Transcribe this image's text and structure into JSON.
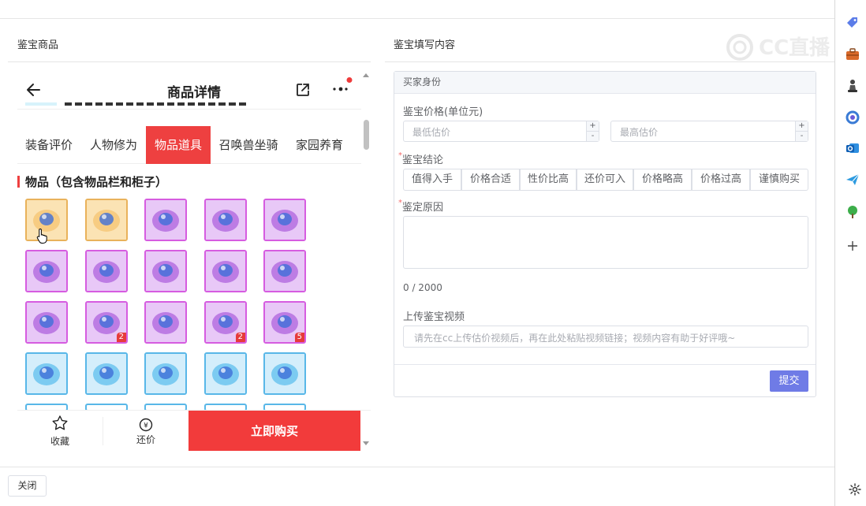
{
  "left_section": {
    "title": "鉴宝商品"
  },
  "right_section": {
    "title": "鉴宝填写内容"
  },
  "phone": {
    "title": "商品详情",
    "tabs": [
      {
        "label": "装备评价",
        "active": false
      },
      {
        "label": "人物修为",
        "active": false
      },
      {
        "label": "物品道具",
        "active": true
      },
      {
        "label": "召唤兽坐骑",
        "active": false
      },
      {
        "label": "家园养育",
        "active": false
      }
    ],
    "items_heading": "物品（包含物品栏和柜子）",
    "items": [
      {
        "name": "item-bracelet-pink",
        "border": "gold",
        "badge": ""
      },
      {
        "name": "item-wings-gold",
        "border": "gold",
        "badge": ""
      },
      {
        "name": "item-ring-blue-gem",
        "border": "purple",
        "badge": ""
      },
      {
        "name": "item-ring-gold-blue",
        "border": "purple",
        "badge": ""
      },
      {
        "name": "item-armor-purple",
        "border": "purple",
        "badge": ""
      },
      {
        "name": "item-amulet-gold",
        "border": "purple",
        "badge": ""
      },
      {
        "name": "item-belt-gold",
        "border": "purple",
        "badge": ""
      },
      {
        "name": "item-necklace-green",
        "border": "purple",
        "badge": ""
      },
      {
        "name": "item-boots-blue",
        "border": "purple",
        "badge": ""
      },
      {
        "name": "item-boots-blue-2",
        "border": "purple",
        "badge": ""
      },
      {
        "name": "item-orb-purple",
        "border": "purple",
        "badge": ""
      },
      {
        "name": "item-book-red",
        "border": "purple",
        "badge": "2"
      },
      {
        "name": "item-crystal-purple",
        "border": "purple",
        "badge": ""
      },
      {
        "name": "item-scroll-gold",
        "border": "purple",
        "badge": "2"
      },
      {
        "name": "item-chest-gold",
        "border": "purple",
        "badge": "5"
      },
      {
        "name": "item-collar-gold",
        "border": "blue",
        "badge": ""
      },
      {
        "name": "item-ring-silver",
        "border": "blue",
        "badge": ""
      },
      {
        "name": "item-robe-purple",
        "border": "blue",
        "badge": ""
      },
      {
        "name": "item-armor-blue",
        "border": "blue",
        "badge": ""
      },
      {
        "name": "item-ring-red-gem",
        "border": "blue",
        "badge": ""
      }
    ],
    "footer": {
      "favorite_label": "收藏",
      "bargain_label": "还价",
      "buy_label": "立即购买"
    }
  },
  "form": {
    "header": "买家身份",
    "price_label": "鉴宝价格(单位元)",
    "min_placeholder": "最低估价",
    "max_placeholder": "最高估价",
    "conclusion_label": "鉴宝结论",
    "conclusions": [
      "值得入手",
      "价格合适",
      "性价比高",
      "还价可入",
      "价格略高",
      "价格过高",
      "谨慎购买"
    ],
    "reason_label": "鉴定原因",
    "counter": "0 / 2000",
    "video_label": "上传鉴宝视频",
    "video_placeholder": "请先在cc上传估价视频后，再在此处粘贴视频链接；视频内容有助于好评哦~",
    "submit_label": "提交"
  },
  "close_label": "关闭",
  "watermark_text": "CC直播",
  "colors": {
    "accent_red": "#f23b3b",
    "submit_blue": "#6f7be6"
  }
}
